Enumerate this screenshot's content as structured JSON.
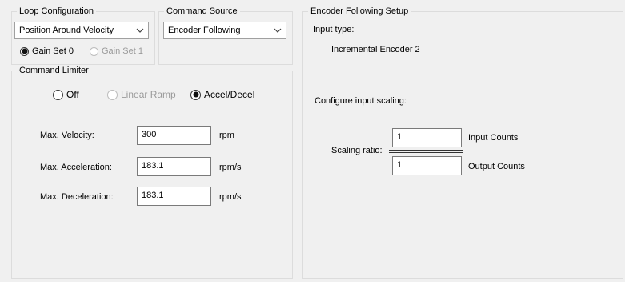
{
  "loop_configuration": {
    "title": "Loop Configuration",
    "selected": "Position Around Velocity",
    "gain_sets": [
      {
        "label": "Gain Set 0",
        "selected": true,
        "enabled": true
      },
      {
        "label": "Gain Set 1",
        "selected": false,
        "enabled": false
      }
    ]
  },
  "command_source": {
    "title": "Command Source",
    "selected": "Encoder Following"
  },
  "command_limiter": {
    "title": "Command Limiter",
    "options": [
      {
        "label": "Off",
        "selected": false,
        "enabled": true
      },
      {
        "label": "Linear Ramp",
        "selected": false,
        "enabled": false
      },
      {
        "label": "Accel/Decel",
        "selected": true,
        "enabled": true
      }
    ],
    "fields": [
      {
        "label": "Max. Velocity:",
        "value": "300",
        "unit": "rpm"
      },
      {
        "label": "Max. Acceleration:",
        "value": "183.1",
        "unit": "rpm/s"
      },
      {
        "label": "Max. Deceleration:",
        "value": "183.1",
        "unit": "rpm/s"
      }
    ]
  },
  "encoder_following_setup": {
    "title": "Encoder Following Setup",
    "input_type_label": "Input type:",
    "input_type_value": "Incremental Encoder 2",
    "scaling_heading": "Configure input scaling:",
    "scaling_ratio_label": "Scaling ratio:",
    "input_counts": {
      "value": "1",
      "label": "Input Counts"
    },
    "output_counts": {
      "value": "1",
      "label": "Output Counts"
    }
  }
}
